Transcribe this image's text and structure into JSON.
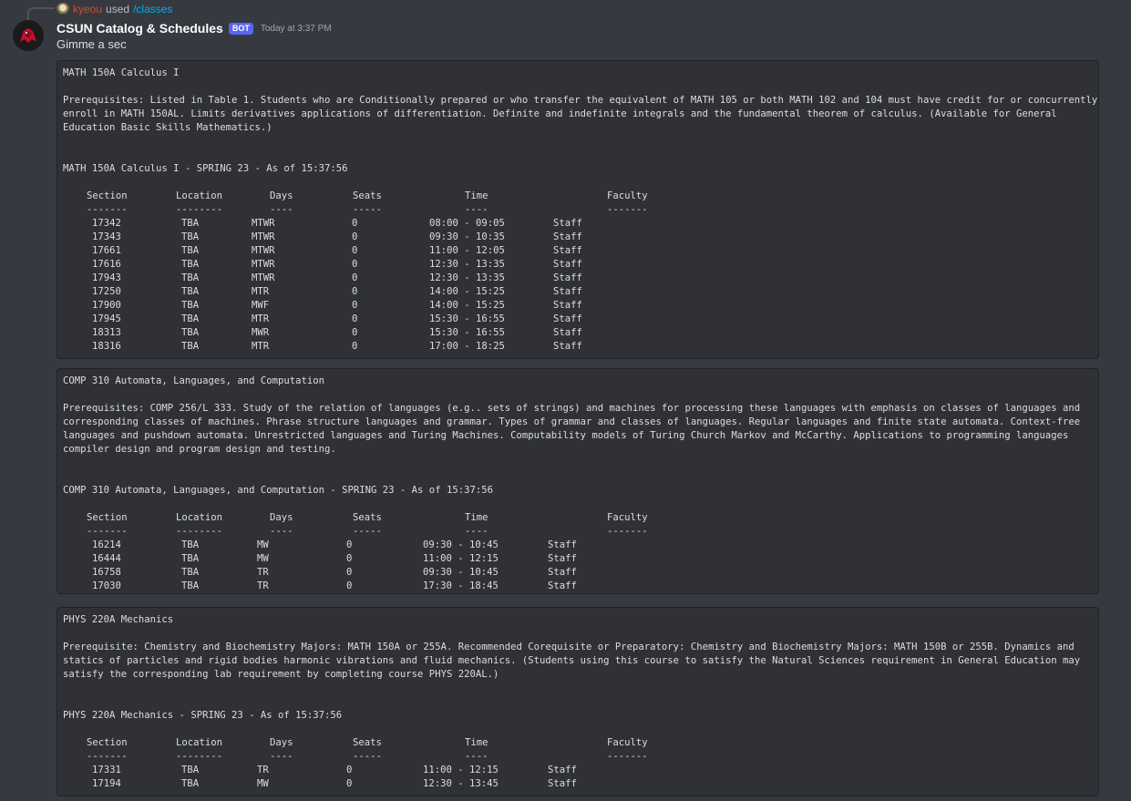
{
  "reply": {
    "user": "kyeou",
    "used_label": "used",
    "command": "/classes"
  },
  "message": {
    "bot_name": "CSUN Catalog & Schedules",
    "bot_tag": "BOT",
    "timestamp": "Today at 3:37 PM",
    "text": "Gimme a sec"
  },
  "headers": {
    "section": "Section",
    "location": "Location",
    "days": "Days",
    "seats": "Seats",
    "time": "Time",
    "faculty": "Faculty",
    "sep_section": "-------",
    "sep_location": "--------",
    "sep_days": "----",
    "sep_seats": "-----",
    "sep_time": "----",
    "sep_faculty": "-------"
  },
  "courses": [
    {
      "title": "MATH 150A Calculus I",
      "description": "Prerequisites: Listed in Table 1. Students who are Conditionally prepared or who transfer the equivalent of MATH 105 or both MATH 102 and 104 must have credit for or concurrently enroll in MATH 150AL. Limits derivatives applications of differentiation. Definite and indefinite integrals and the fundamental theorem of calculus. (Available for General Education Basic Skills Mathematics.)",
      "schedule_title": "MATH 150A Calculus I - SPRING 23 - As of 15:37:56",
      "rows": [
        {
          "section": "17342",
          "location": "TBA",
          "days": "MTWR",
          "seats": "0",
          "time": "08:00 - 09:05",
          "faculty": "Staff"
        },
        {
          "section": "17343",
          "location": "TBA",
          "days": "MTWR",
          "seats": "0",
          "time": "09:30 - 10:35",
          "faculty": "Staff"
        },
        {
          "section": "17661",
          "location": "TBA",
          "days": "MTWR",
          "seats": "0",
          "time": "11:00 - 12:05",
          "faculty": "Staff"
        },
        {
          "section": "17616",
          "location": "TBA",
          "days": "MTWR",
          "seats": "0",
          "time": "12:30 - 13:35",
          "faculty": "Staff"
        },
        {
          "section": "17943",
          "location": "TBA",
          "days": "MTWR",
          "seats": "0",
          "time": "12:30 - 13:35",
          "faculty": "Staff"
        },
        {
          "section": "17250",
          "location": "TBA",
          "days": "MTR",
          "seats": "0",
          "time": "14:00 - 15:25",
          "faculty": "Staff"
        },
        {
          "section": "17900",
          "location": "TBA",
          "days": "MWF",
          "seats": "0",
          "time": "14:00 - 15:25",
          "faculty": "Staff"
        },
        {
          "section": "17945",
          "location": "TBA",
          "days": "MTR",
          "seats": "0",
          "time": "15:30 - 16:55",
          "faculty": "Staff"
        },
        {
          "section": "18313",
          "location": "TBA",
          "days": "MWR",
          "seats": "0",
          "time": "15:30 - 16:55",
          "faculty": "Staff"
        },
        {
          "section": "18316",
          "location": "TBA",
          "days": "MTR",
          "seats": "0",
          "time": "17:00 - 18:25",
          "faculty": "Staff"
        }
      ]
    },
    {
      "title": "COMP 310 Automata, Languages, and Computation",
      "description": "Prerequisites: COMP 256/L 333. Study of the relation of languages (e.g.. sets of strings) and machines for processing these languages with emphasis on classes of languages and corresponding classes of machines. Phrase structure languages and grammar. Types of grammar and classes of languages. Regular languages and finite state automata. Context-free languages and pushdown automata. Unrestricted languages and Turing Machines. Computability models of Turing Church Markov and McCarthy. Applications to programming languages compiler design and program design and testing.",
      "schedule_title": "COMP 310 Automata, Languages, and Computation - SPRING 23 - As of 15:37:56",
      "rows": [
        {
          "section": "16214",
          "location": "TBA",
          "days": "MW",
          "seats": "0",
          "time": "09:30 - 10:45",
          "faculty": "Staff"
        },
        {
          "section": "16444",
          "location": "TBA",
          "days": "MW",
          "seats": "0",
          "time": "11:00 - 12:15",
          "faculty": "Staff"
        },
        {
          "section": "16758",
          "location": "TBA",
          "days": "TR",
          "seats": "0",
          "time": "09:30 - 10:45",
          "faculty": "Staff"
        },
        {
          "section": "17030",
          "location": "TBA",
          "days": "TR",
          "seats": "0",
          "time": "17:30 - 18:45",
          "faculty": "Staff"
        }
      ]
    },
    {
      "title": "PHYS 220A Mechanics",
      "description": "Prerequisite: Chemistry and Biochemistry Majors: MATH 150A or 255A. Recommended Corequisite or Preparatory: Chemistry and Biochemistry Majors: MATH 150B or 255B. Dynamics and statics of particles and rigid bodies harmonic vibrations and fluid mechanics. (Students using this course to satisfy the Natural Sciences requirement in General Education may satisfy the corresponding lab requirement by completing course PHYS 220AL.)",
      "schedule_title": "PHYS 220A Mechanics - SPRING 23 - As of 15:37:56",
      "rows": [
        {
          "section": "17331",
          "location": "TBA",
          "days": "TR",
          "seats": "0",
          "time": "11:00 - 12:15",
          "faculty": "Staff"
        },
        {
          "section": "17194",
          "location": "TBA",
          "days": "MW",
          "seats": "0",
          "time": "12:30 - 13:45",
          "faculty": "Staff"
        }
      ]
    }
  ]
}
